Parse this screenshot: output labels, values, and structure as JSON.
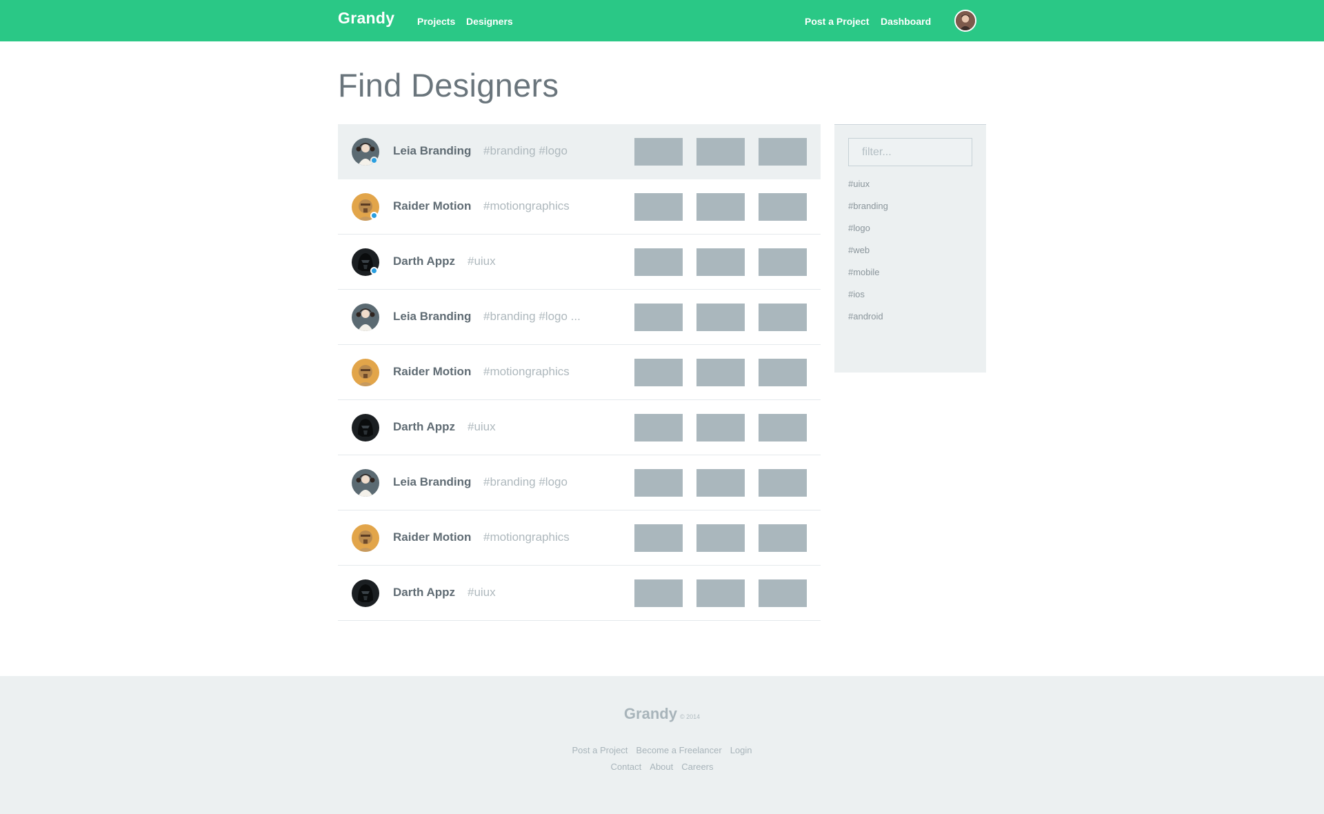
{
  "header": {
    "brand": "Grandy",
    "nav": {
      "projects": "Projects",
      "designers": "Designers"
    },
    "actions": {
      "post_project": "Post a Project",
      "dashboard": "Dashboard"
    }
  },
  "page": {
    "title": "Find Designers"
  },
  "designers": [
    {
      "name": "Leia Branding",
      "tags": "#branding #logo",
      "avatar": "leia",
      "online": true,
      "selected": true
    },
    {
      "name": "Raider Motion",
      "tags": "#motiongraphics",
      "avatar": "raider",
      "online": true,
      "selected": false
    },
    {
      "name": "Darth Appz",
      "tags": "#uiux",
      "avatar": "darth",
      "online": true,
      "selected": false
    },
    {
      "name": "Leia Branding",
      "tags": "#branding #logo ...",
      "avatar": "leia",
      "online": false,
      "selected": false
    },
    {
      "name": "Raider Motion",
      "tags": "#motiongraphics",
      "avatar": "raider",
      "online": false,
      "selected": false
    },
    {
      "name": "Darth Appz",
      "tags": "#uiux",
      "avatar": "darth",
      "online": false,
      "selected": false
    },
    {
      "name": "Leia Branding",
      "tags": "#branding #logo",
      "avatar": "leia",
      "online": false,
      "selected": false
    },
    {
      "name": "Raider Motion",
      "tags": "#motiongraphics",
      "avatar": "raider",
      "online": false,
      "selected": false
    },
    {
      "name": "Darth Appz",
      "tags": "#uiux",
      "avatar": "darth",
      "online": false,
      "selected": false
    }
  ],
  "sidebar": {
    "filter_placeholder": "filter...",
    "filter_value": "",
    "tags": [
      "#uiux",
      "#branding",
      "#logo",
      "#web",
      "#mobile",
      "#ios",
      "#android"
    ]
  },
  "footer": {
    "brand": "Grandy",
    "copyright": "© 2014",
    "links_row1": [
      "Post a Project",
      "Become a Freelancer",
      "Login"
    ],
    "links_row2": [
      "Contact",
      "About",
      "Careers"
    ]
  },
  "colors": {
    "brand_green": "#2ac886",
    "online_blue": "#2a9fe0",
    "thumb_gray": "#aab7bd",
    "panel_gray": "#ecf0f1"
  }
}
